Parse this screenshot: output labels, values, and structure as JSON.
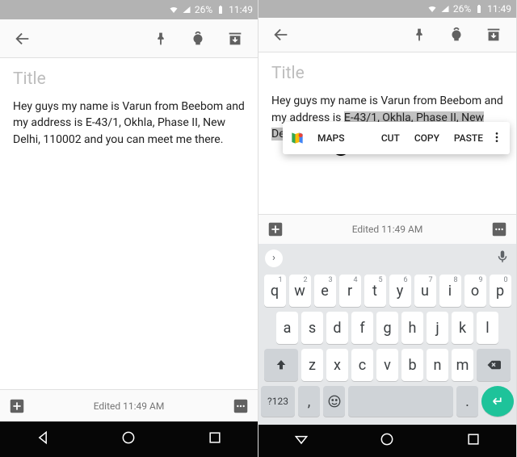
{
  "status": {
    "battery": "26%",
    "time": "11:49"
  },
  "note": {
    "title_placeholder": "Title",
    "body_pre": "Hey guys my name is Varun from Beebom and my address is ",
    "body_sel": "E-43/1, Okhla, Phase II, New Delhi, 110002",
    "body_post": " and you can meet me there.",
    "edited": "Edited 11:49 AM"
  },
  "ctx": {
    "maps": "MAPS",
    "cut": "CUT",
    "copy": "COPY",
    "paste": "PASTE"
  },
  "kb": {
    "row1": [
      "q",
      "w",
      "e",
      "r",
      "t",
      "y",
      "u",
      "i",
      "o",
      "p"
    ],
    "nums": [
      "1",
      "2",
      "3",
      "4",
      "5",
      "6",
      "7",
      "8",
      "9",
      "0"
    ],
    "row2": [
      "a",
      "s",
      "d",
      "f",
      "g",
      "h",
      "j",
      "k",
      "l"
    ],
    "row3": [
      "z",
      "x",
      "c",
      "v",
      "b",
      "n",
      "m"
    ],
    "sym": "?123",
    "comma": ",",
    "period": "."
  }
}
